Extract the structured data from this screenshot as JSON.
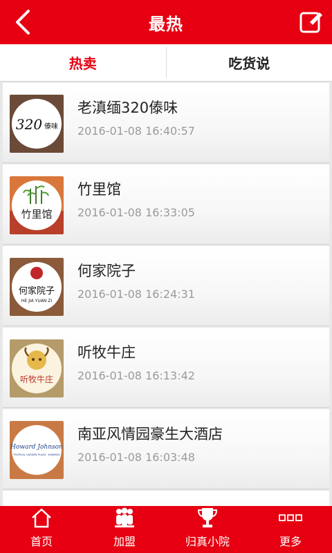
{
  "header": {
    "title": "最热"
  },
  "tabs": [
    {
      "label": "热卖",
      "active": true
    },
    {
      "label": "吃货说",
      "active": false
    }
  ],
  "list": [
    {
      "name": "老滇缅320傣味",
      "time": "2016-01-08 16:40:57",
      "logo": "320-dai-logo"
    },
    {
      "name": "竹里馆",
      "time": "2016-01-08 16:33:05",
      "logo": "bamboo-logo"
    },
    {
      "name": "何家院子",
      "time": "2016-01-08 16:24:31",
      "logo": "hejia-logo"
    },
    {
      "name": "听牧牛庄",
      "time": "2016-01-08 16:13:42",
      "logo": "tingmu-logo"
    },
    {
      "name": "南亚风情园豪生大酒店",
      "time": "2016-01-08 16:03:48",
      "logo": "howard-johnson-logo"
    }
  ],
  "logo_text": {
    "l1": "320",
    "l1b": "傣味",
    "l2": "竹里馆",
    "l3": "何家院子",
    "l3b": "HE JIA YUAN ZI",
    "l4": "听牧牛庄",
    "l5a": "Howard Johnson",
    "l5b": "TROPICAL GARDEN PLAZA · KUNMING"
  },
  "bottom_nav": [
    {
      "label": "首页",
      "icon": "home-icon"
    },
    {
      "label": "加盟",
      "icon": "group-icon"
    },
    {
      "label": "归真小院",
      "icon": "trophy-icon"
    },
    {
      "label": "更多",
      "icon": "more-icon"
    }
  ],
  "colors": {
    "brand_red": "#e60012",
    "active_tab": "#e60012",
    "timestamp_gray": "#9a9a9a"
  }
}
